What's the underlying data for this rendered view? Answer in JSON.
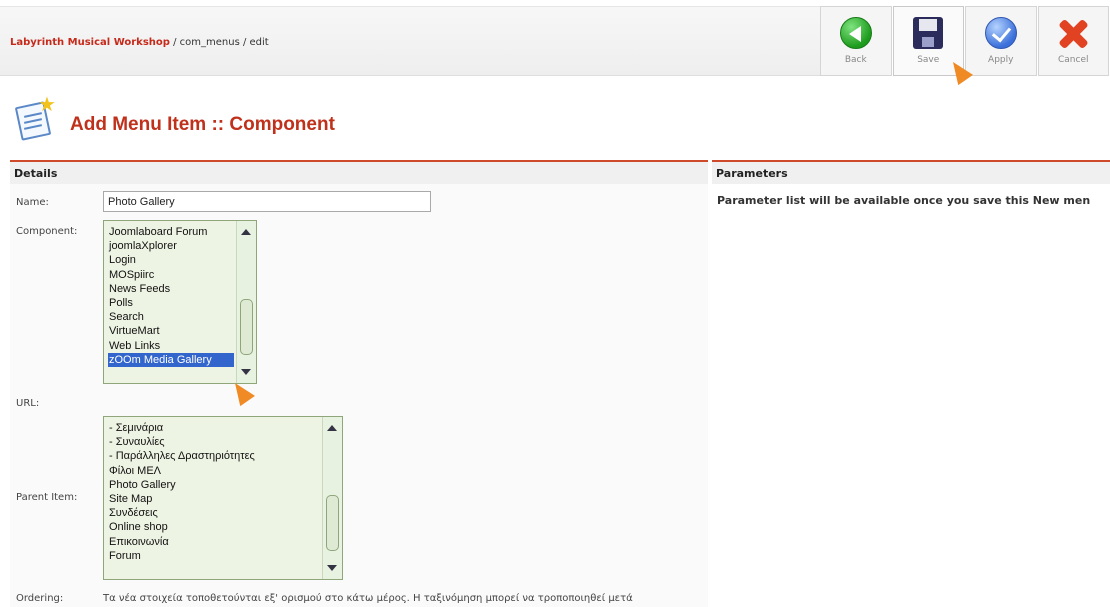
{
  "header": {
    "site_name": "Labyrinth Musical Workshop",
    "path": " / com_menus / edit"
  },
  "toolbar": {
    "back_label": "Back",
    "save_label": "Save",
    "apply_label": "Apply",
    "cancel_label": "Cancel"
  },
  "page": {
    "title": "Add Menu Item :: Component"
  },
  "details": {
    "heading": "Details",
    "name_label": "Name:",
    "name_value": "Photo Gallery",
    "component_label": "Component:",
    "component_options": [
      "Joomlaboard Forum",
      "joomlaXplorer",
      "Login",
      "MOSpiirc",
      "News Feeds",
      "Polls",
      "Search",
      "VirtueMart",
      "Web Links",
      "zOOm Media Gallery"
    ],
    "component_selected": "zOOm Media Gallery",
    "url_label": "URL:",
    "parent_label": "Parent Item:",
    "parent_options": [
      "- Σεμινάρια",
      "- Συναυλίες",
      "- Παράλληλες Δραστηριότητες",
      "Φίλοι ΜΕΛ",
      "Photo Gallery",
      "Site Map",
      "Συνδέσεις",
      "Online shop",
      "Επικοινωνία",
      "Forum"
    ],
    "ordering_label": "Ordering:",
    "ordering_text": "Τα νέα στοιχεία τοποθετούνται εξ' ορισμού στο κάτω μέρος. Η ταξινόμηση μπορεί να τροποποιηθεί μετά"
  },
  "parameters": {
    "heading": "Parameters",
    "message": "Parameter list will be available once you save this New men"
  },
  "icons": {
    "back": "back-arrow-icon",
    "save": "floppy-disk-icon",
    "apply": "checkmark-icon",
    "cancel": "x-icon",
    "page": "menu-item-add-icon",
    "cursor": "pointer-cursor-icon"
  },
  "colors": {
    "accent": "#c0311b",
    "selection": "#3366cc",
    "listbox_bg": "#eef4e4",
    "cursor": "#f08a24"
  }
}
